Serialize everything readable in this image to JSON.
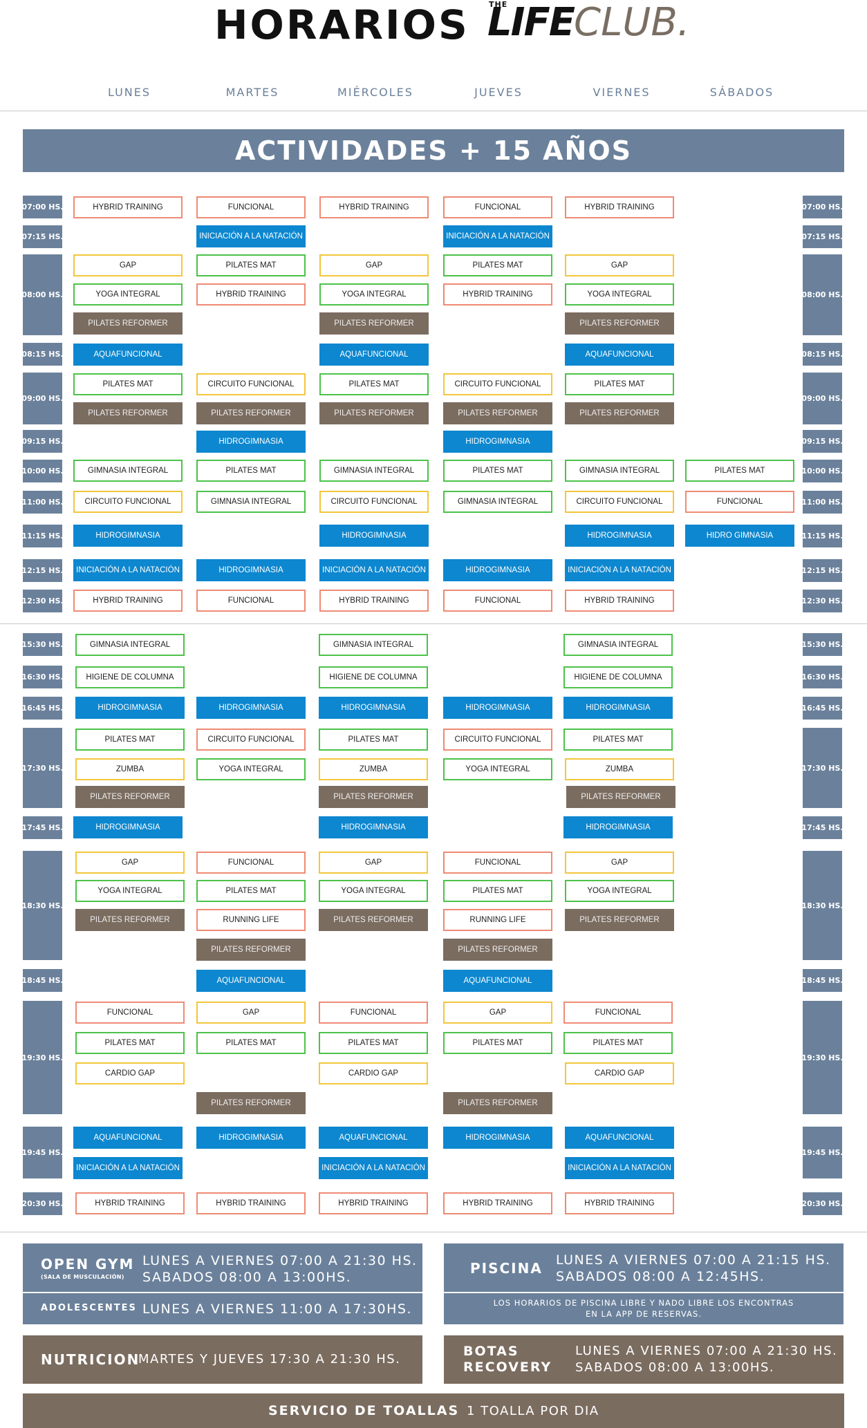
{
  "header": {
    "title": "HORARIOS",
    "logo": {
      "the": "THE",
      "life": "LIFE",
      "club": "CLUB."
    }
  },
  "days": [
    "LUNES",
    "MARTES",
    "MIÉRCOLES",
    "JUEVES",
    "VIERNES",
    "SÁBADOS"
  ],
  "banner": "ACTIVIDADES + 15 AÑOS",
  "schedule_labels": {
    "t0700": "07:00 HS.",
    "t0715": "07:15 HS.",
    "t0800": "08:00 HS.",
    "t0815": "08:15 HS.",
    "t0900": "09:00 HS.",
    "t0915": "09:15 HS.",
    "t1000": "10:00 HS.",
    "t1100": "11:00 HS.",
    "t1115": "11:15 HS.",
    "t1215": "12:15 HS.",
    "t1230": "12:30 HS.",
    "t1530": "15:30 HS.",
    "t1630": "16:30 HS.",
    "t1645": "16:45 HS.",
    "t1730": "17:30 HS.",
    "t1745": "17:45 HS.",
    "t1830": "18:30 HS.",
    "t1845": "18:45 HS.",
    "t1930": "19:30 HS.",
    "t1945": "19:45 HS.",
    "t2030": "20:30 HS."
  },
  "classes": {
    "hybrid": "HYBRID TRAINING",
    "funcional": "FUNCIONAL",
    "iniciacion": "INICIACIÓN A LA NATACIÓN",
    "gap": "GAP",
    "pilates_mat": "PILATES MAT",
    "yoga": "YOGA INTEGRAL",
    "reformer": "PILATES REFORMER",
    "aquafuncional": "AQUAFUNCIONAL",
    "circuito": "CIRCUITO FUNCIONAL",
    "hidrogimnasia": "HIDROGIMNASIA",
    "gimnasia": "GIMNASIA INTEGRAL",
    "hidro_gimnasia": "HIDRO GIMNASIA",
    "higiene": "HIGIENE DE COLUMNA",
    "zumba": "ZUMBA",
    "running": "RUNNING LIFE",
    "cardio_gap": "CARDIO GAP"
  },
  "colors": {
    "slate": "#6b819b",
    "blue": "#0d87cf",
    "brown": "#7b6c60",
    "green_border": "#4cc24a",
    "orange_border": "#ef8a74",
    "yellow_border": "#f3c63c"
  },
  "info": {
    "open_gym": {
      "label": "OPEN GYM",
      "sub": "(SALA DE MUSCULACIÓN)",
      "line1": "LUNES A VIERNES 07:00 A 21:30 HS.",
      "line2": "SABADOS 08:00 A 13:00HS."
    },
    "adolescentes": {
      "label": "ADOLESCENTES",
      "text": "LUNES A VIERNES 11:00 A 17:30HS."
    },
    "piscina": {
      "label": "PISCINA",
      "line1": "LUNES A VIERNES 07:00 A 21:15 HS.",
      "line2": "SABADOS 08:00 A 12:45HS."
    },
    "piscina_note": {
      "line1": "LOS HORARIOS DE PISCINA LIBRE Y NADO LIBRE LOS ENCONTRAS",
      "line2": "EN LA APP DE RESERVAS."
    },
    "nutricion": {
      "label": "NUTRICION",
      "text": "MARTES Y JUEVES 17:30 A 21:30 HS."
    },
    "botas": {
      "label1": "BOTAS",
      "label2": "RECOVERY",
      "line1": "LUNES A VIERNES 07:00 A 21:30 HS.",
      "line2": "SABADOS 08:00 A 13:00HS."
    },
    "toallas": {
      "label": "SERVICIO DE TOALLAS",
      "text": "1 TOALLA POR DIA"
    }
  }
}
